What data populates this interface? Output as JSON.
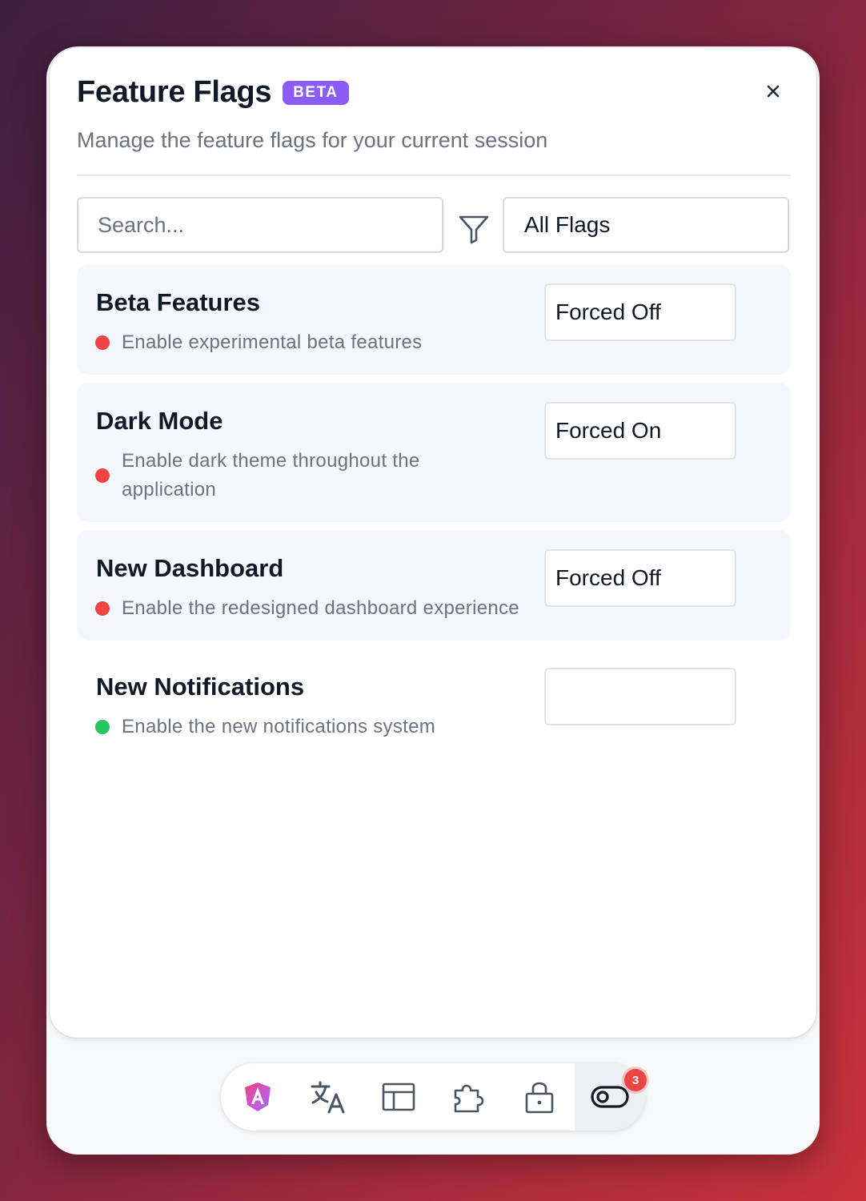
{
  "header": {
    "title": "Feature Flags",
    "badge": "BETA",
    "subtitle": "Manage the feature flags for your current session"
  },
  "toolbar": {
    "search_placeholder": "Search...",
    "filter_value": "All Flags"
  },
  "flags": [
    {
      "name": "Beta Features",
      "description": "Enable experimental beta features",
      "status_color": "#ef4444",
      "override": "Forced Off"
    },
    {
      "name": "Dark Mode",
      "description_line1": "Enable dark theme throughout the",
      "description_line2": "application",
      "status_color": "#ef4444",
      "override": "Forced On"
    },
    {
      "name": "New Dashboard",
      "description": "Enable the redesigned dashboard experience",
      "status_color": "#ef4444",
      "override": "Forced Off"
    },
    {
      "name": "New Notifications",
      "description": "Enable the new notifications system",
      "status_color": "#22c55e",
      "override": ""
    }
  ],
  "dock": {
    "items": [
      "angular-logo-icon",
      "translate-icon",
      "layout-icon",
      "puzzle-icon",
      "lock-icon",
      "toggle-icon"
    ],
    "notification_count": "3"
  },
  "colors": {
    "accent": "#8b5cf6",
    "enabled": "#22c55e",
    "disabled": "#ef4444"
  }
}
